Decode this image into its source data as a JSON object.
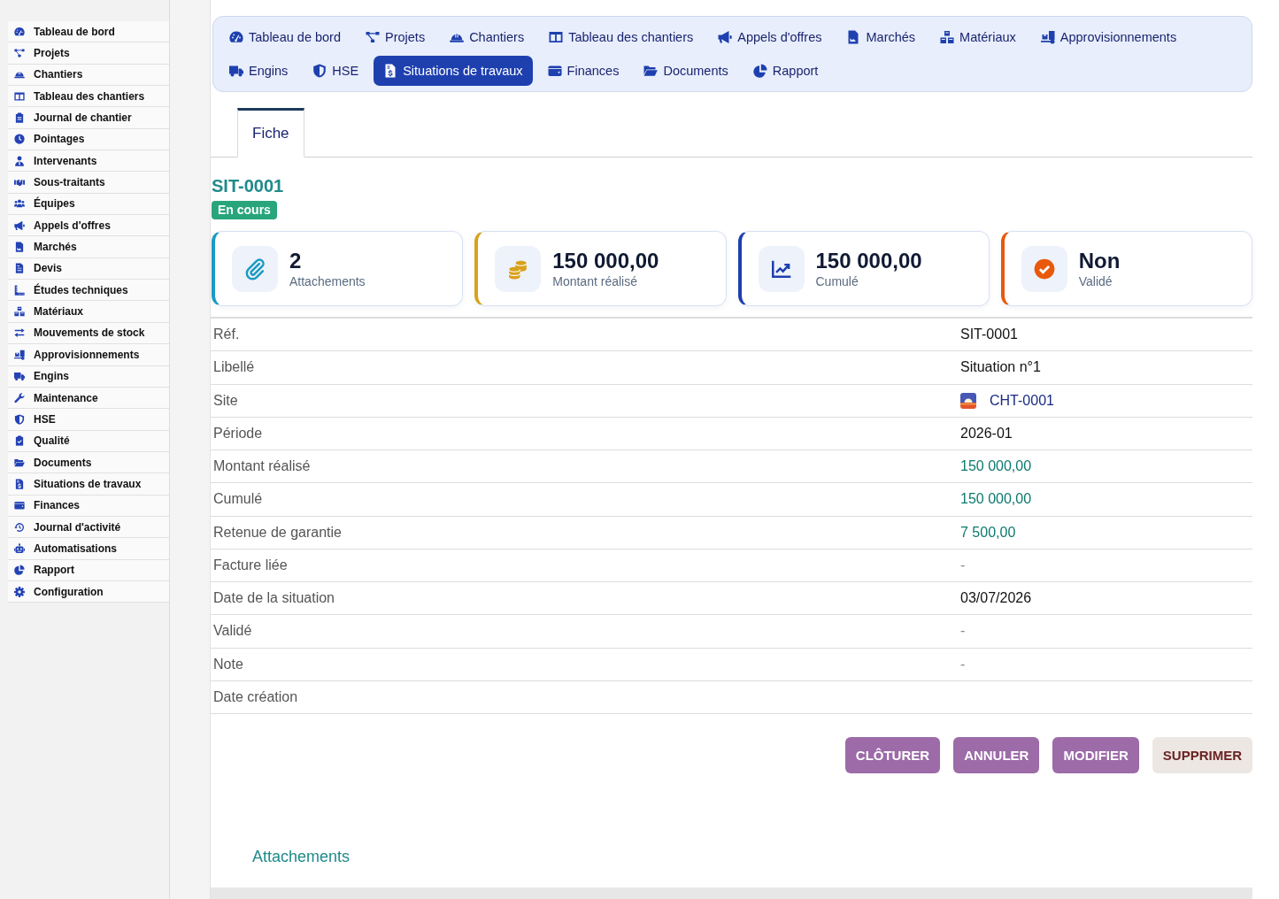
{
  "sidebar": {
    "items": [
      {
        "label": "Tableau de bord",
        "selected": false
      },
      {
        "label": "Projets",
        "selected": false
      },
      {
        "label": "Chantiers",
        "selected": false
      },
      {
        "label": "Tableau des chantiers",
        "selected": false
      },
      {
        "label": "Journal de chantier",
        "selected": false
      },
      {
        "label": "Pointages",
        "selected": false
      },
      {
        "label": "Intervenants",
        "selected": false
      },
      {
        "label": "Sous-traitants",
        "selected": false
      },
      {
        "label": "Équipes",
        "selected": false
      },
      {
        "label": "Appels d'offres",
        "selected": false
      },
      {
        "label": "Marchés",
        "selected": false
      },
      {
        "label": "Devis",
        "selected": false
      },
      {
        "label": "Études techniques",
        "selected": false
      },
      {
        "label": "Matériaux",
        "selected": false
      },
      {
        "label": "Mouvements de stock",
        "selected": false
      },
      {
        "label": "Approvisionnements",
        "selected": false
      },
      {
        "label": "Engins",
        "selected": false
      },
      {
        "label": "Maintenance",
        "selected": false
      },
      {
        "label": "HSE",
        "selected": false
      },
      {
        "label": "Qualité",
        "selected": false
      },
      {
        "label": "Documents",
        "selected": false
      },
      {
        "label": "Situations de travaux",
        "selected": false
      },
      {
        "label": "Finances",
        "selected": false
      },
      {
        "label": "Journal d'activité",
        "selected": false
      },
      {
        "label": "Automatisations",
        "selected": false
      },
      {
        "label": "Rapport",
        "selected": false
      },
      {
        "label": "Configuration",
        "selected": false
      }
    ]
  },
  "nav": {
    "items": [
      {
        "label": "Tableau de bord",
        "selected": false
      },
      {
        "label": "Projets",
        "selected": false
      },
      {
        "label": "Chantiers",
        "selected": false
      },
      {
        "label": "Tableau des chantiers",
        "selected": false
      },
      {
        "label": "Appels d'offres",
        "selected": false
      },
      {
        "label": "Marchés",
        "selected": false
      },
      {
        "label": "Matériaux",
        "selected": false
      },
      {
        "label": "Approvisionnements",
        "selected": false
      },
      {
        "label": "Engins",
        "selected": false
      },
      {
        "label": "HSE",
        "selected": false
      },
      {
        "label": "Situations de travaux",
        "selected": true
      },
      {
        "label": "Finances",
        "selected": false
      },
      {
        "label": "Documents",
        "selected": false
      },
      {
        "label": "Rapport",
        "selected": false
      }
    ]
  },
  "tabs": [
    {
      "label": "Fiche",
      "selected": true
    }
  ],
  "record": {
    "title": "SIT-0001",
    "status": "En cours"
  },
  "stats": [
    {
      "value": "2",
      "label": "Attachements",
      "color": "#1b9ac2"
    },
    {
      "value": "150 000,00",
      "label": "Montant réalisé",
      "color": "#d9a11c"
    },
    {
      "value": "150 000,00",
      "label": "Cumulé",
      "color": "#1e3fae"
    },
    {
      "value": "Non",
      "label": "Validé",
      "color": "#e8590c"
    }
  ],
  "details": [
    {
      "label": "Réf.",
      "value": "SIT-0001",
      "kind": "text"
    },
    {
      "label": "Libellé",
      "value": "Situation n°1",
      "kind": "text"
    },
    {
      "label": "Site",
      "value": "CHT-0001",
      "kind": "link"
    },
    {
      "label": "Période",
      "value": "2026-01",
      "kind": "text"
    },
    {
      "label": "Montant réalisé",
      "value": "150 000,00",
      "kind": "amount"
    },
    {
      "label": "Cumulé",
      "value": "150 000,00",
      "kind": "amount"
    },
    {
      "label": "Retenue de garantie",
      "value": "7 500,00",
      "kind": "amount"
    },
    {
      "label": "Facture liée",
      "value": "-",
      "kind": "empty"
    },
    {
      "label": "Date de la situation",
      "value": "03/07/2026",
      "kind": "text"
    },
    {
      "label": "Validé",
      "value": "-",
      "kind": "empty"
    },
    {
      "label": "Note",
      "value": "-",
      "kind": "empty"
    },
    {
      "label": "Date création",
      "kind": "text"
    }
  ],
  "actions": [
    {
      "label": "CLÔTURER",
      "kind": "primary"
    },
    {
      "label": "ANNULER",
      "kind": "primary"
    },
    {
      "label": "MODIFIER",
      "kind": "primary"
    },
    {
      "label": "SUPPRIMER",
      "kind": "danger"
    }
  ],
  "section": {
    "title": "Attachements"
  }
}
